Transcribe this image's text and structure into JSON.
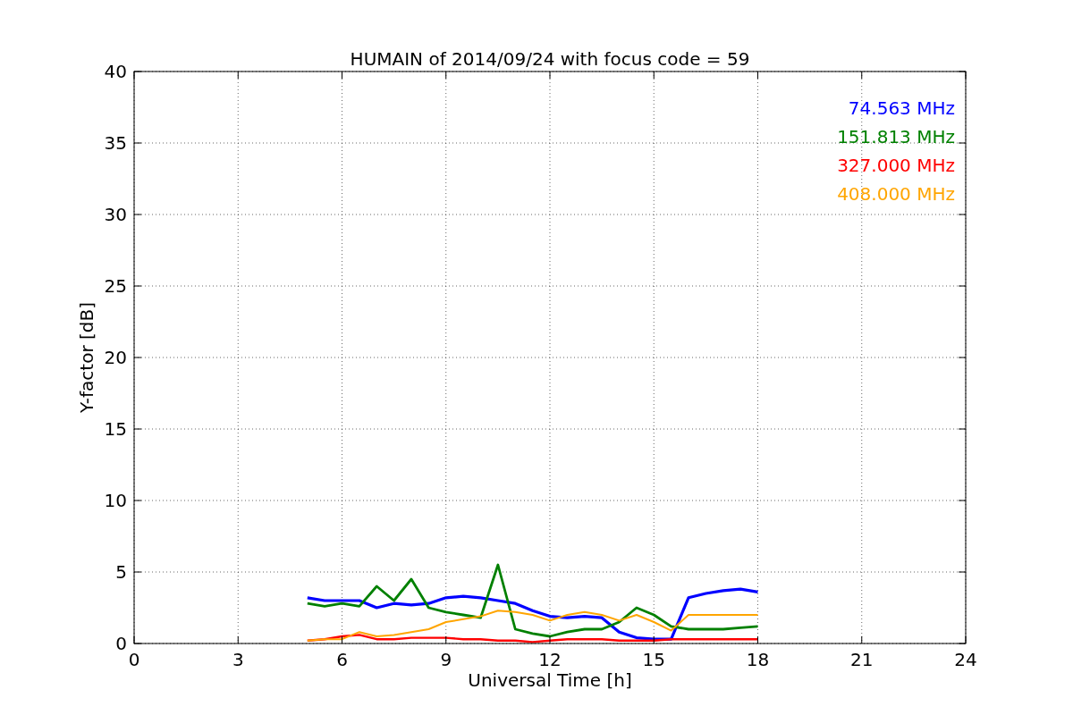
{
  "figure": {
    "chart_data": {
      "type": "line",
      "title": "HUMAIN of 2014/09/24 with focus code = 59",
      "xlabel": "Universal Time [h]",
      "ylabel": "Y-factor [dB]",
      "x": [
        5,
        5.5,
        6,
        6.5,
        7,
        7.5,
        8,
        8.5,
        9,
        9.5,
        10,
        10.5,
        11,
        11.5,
        12,
        12.5,
        13,
        13.5,
        14,
        14.5,
        15,
        15.5,
        16,
        16.5,
        17,
        17.5,
        18
      ],
      "series": [
        {
          "name": "74.563 MHz",
          "color": "#0000ff",
          "values": [
            3.2,
            3.0,
            3.0,
            3.0,
            2.5,
            2.8,
            2.7,
            2.8,
            3.2,
            3.3,
            3.2,
            3.0,
            2.8,
            2.3,
            1.9,
            1.8,
            1.9,
            1.8,
            0.8,
            0.4,
            0.3,
            0.3,
            3.2,
            3.5,
            3.7,
            3.8,
            3.6
          ]
        },
        {
          "name": "151.813 MHz",
          "color": "#008000",
          "values": [
            2.8,
            2.6,
            2.8,
            2.6,
            4.0,
            3.0,
            4.5,
            2.5,
            2.2,
            2.0,
            1.8,
            5.5,
            1.0,
            0.7,
            0.5,
            0.8,
            1.0,
            1.0,
            1.5,
            2.5,
            2.0,
            1.2,
            1.0,
            1.0,
            1.0,
            1.1,
            1.2
          ]
        },
        {
          "name": "327.000 MHz",
          "color": "#ff0000",
          "values": [
            0.2,
            0.3,
            0.5,
            0.6,
            0.3,
            0.3,
            0.4,
            0.4,
            0.4,
            0.3,
            0.3,
            0.2,
            0.2,
            0.1,
            0.2,
            0.3,
            0.3,
            0.3,
            0.2,
            0.2,
            0.2,
            0.3,
            0.3,
            0.3,
            0.3,
            0.3,
            0.3
          ]
        },
        {
          "name": "408.000 MHz",
          "color": "#ffa500",
          "values": [
            0.2,
            0.3,
            0.3,
            0.8,
            0.5,
            0.6,
            0.8,
            1.0,
            1.5,
            1.7,
            1.9,
            2.3,
            2.2,
            2.0,
            1.6,
            2.0,
            2.2,
            2.0,
            1.6,
            2.0,
            1.5,
            0.9,
            2.0,
            2.0,
            2.0,
            2.0,
            2.0
          ]
        }
      ],
      "grid": true,
      "xlim": [
        0,
        24
      ],
      "ylim": [
        0,
        40
      ],
      "xticks": [
        0,
        3,
        6,
        9,
        12,
        15,
        18,
        21,
        24
      ],
      "yticks": [
        0,
        5,
        10,
        15,
        20,
        25,
        30,
        35,
        40
      ]
    }
  }
}
